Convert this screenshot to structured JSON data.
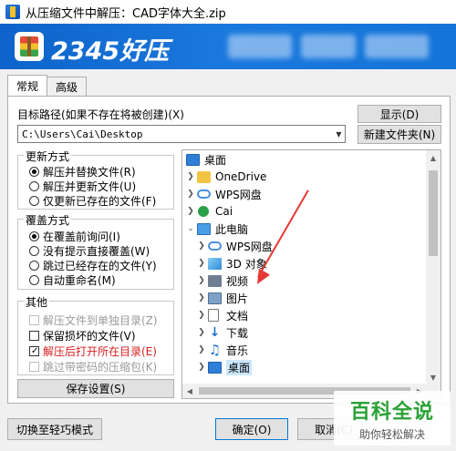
{
  "window": {
    "title": "从压缩文件中解压：CAD字体大全.zip"
  },
  "brand": {
    "name": "2345好压"
  },
  "tabs": [
    {
      "label": "常规",
      "active": true
    },
    {
      "label": "高级",
      "active": false
    }
  ],
  "target": {
    "label": "目标路径(如果不存在将被创建)(X)",
    "path": "C:\\Users\\Cai\\Desktop",
    "show_button": "显示(D)",
    "new_folder_button": "新建文件夹(N)"
  },
  "update_mode": {
    "title": "更新方式",
    "options": [
      {
        "label": "解压并替换文件(R)",
        "selected": true
      },
      {
        "label": "解压并更新文件(U)",
        "selected": false
      },
      {
        "label": "仅更新已存在的文件(F)",
        "selected": false
      }
    ]
  },
  "overwrite_mode": {
    "title": "覆盖方式",
    "options": [
      {
        "label": "在覆盖前询问(I)",
        "selected": true
      },
      {
        "label": "没有提示直接覆盖(W)",
        "selected": false
      },
      {
        "label": "跳过已经存在的文件(Y)",
        "selected": false
      },
      {
        "label": "自动重命名(M)",
        "selected": false
      }
    ]
  },
  "other": {
    "title": "其他",
    "options": [
      {
        "label": "解压文件到单独目录(Z)",
        "checked": false,
        "enabled": false,
        "highlight": false
      },
      {
        "label": "保留损坏的文件(V)",
        "checked": false,
        "enabled": true,
        "highlight": false
      },
      {
        "label": "解压后打开所在目录(E)",
        "checked": true,
        "enabled": true,
        "highlight": true
      },
      {
        "label": "跳过带密码的压缩包(K)",
        "checked": false,
        "enabled": false,
        "highlight": false
      }
    ]
  },
  "save_settings_button": "保存设置(S)",
  "tree": [
    {
      "label": "桌面",
      "icon": "desktop-icon",
      "chevron": ""
    },
    {
      "label": "OneDrive",
      "icon": "folder-icon",
      "chevron": ">"
    },
    {
      "label": "WPS网盘",
      "icon": "cloud-icon",
      "chevron": ">"
    },
    {
      "label": "Cai",
      "icon": "user-icon",
      "chevron": ">"
    },
    {
      "label": "此电脑",
      "icon": "computer-icon",
      "chevron": "v"
    },
    {
      "label": "WPS网盘",
      "icon": "cloud-icon",
      "chevron": ">"
    },
    {
      "label": "3D 对象",
      "icon": "cube-icon",
      "chevron": ">"
    },
    {
      "label": "视频",
      "icon": "video-icon",
      "chevron": ">"
    },
    {
      "label": "图片",
      "icon": "image-icon",
      "chevron": ">"
    },
    {
      "label": "文档",
      "icon": "document-icon",
      "chevron": ">"
    },
    {
      "label": "下载",
      "icon": "download-icon",
      "chevron": ">"
    },
    {
      "label": "音乐",
      "icon": "music-icon",
      "chevron": ">"
    },
    {
      "label": "桌面",
      "icon": "desktop-icon",
      "chevron": ">",
      "selected": true
    }
  ],
  "footer": {
    "simple_mode_button": "切换至轻巧模式",
    "ok_button": "确定(O)",
    "cancel_button": "取消(C)"
  },
  "watermark": {
    "title": "百科全说",
    "subtitle": "助你轻松解决"
  },
  "colors": {
    "banner": "#1474d8",
    "accent": "#2aa136",
    "annotation": "#e53935"
  }
}
